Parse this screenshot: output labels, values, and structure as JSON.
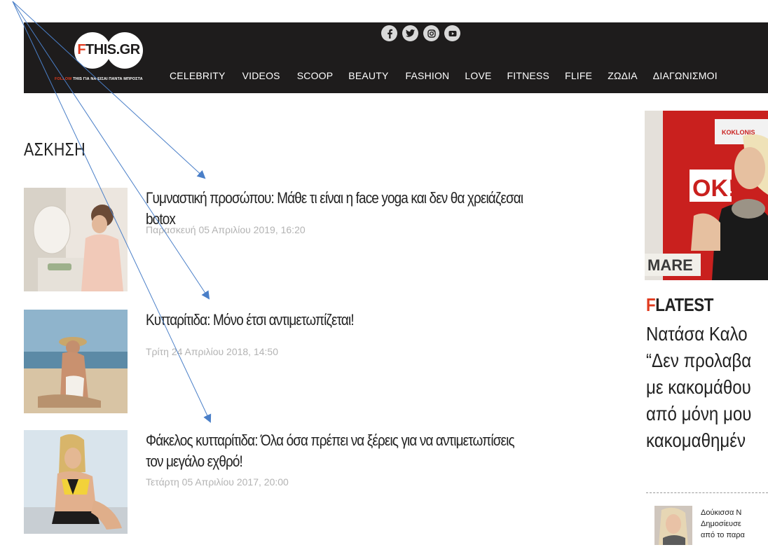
{
  "header": {
    "logo_text_f": "F",
    "logo_text_rest": "THIS.GR",
    "tagline_accent": "FOLLOW",
    "tagline_rest": " THIS ΓΙΑ ΝΑ ΕΙΣΑΙ ΠΑΝΤΑ ΜΠΡΟΣΤΑ",
    "socials": [
      "facebook-icon",
      "twitter-icon",
      "instagram-icon",
      "youtube-icon"
    ],
    "nav": [
      "CELEBRITY",
      "VIDEOS",
      "SCOOP",
      "BEAUTY",
      "FASHION",
      "LOVE",
      "FITNESS",
      "FLIFE",
      "ΖΩΔΙΑ",
      "ΔΙΑΓΩΝΙΣΜΟΙ"
    ]
  },
  "section": {
    "title": "ΑΣΚΗΣΗ"
  },
  "articles": [
    {
      "title": "Γυμναστική προσώπου: Μάθε τι είναι η face yoga και δεν θα χρειάζεσαι botox",
      "date": "Παρασκευή 05 Απριλίου 2019, 16:20"
    },
    {
      "title": "Κυτταρίτιδα: Μόνο έτσι αντιμετωπίζεται!",
      "date": "Τρίτη 24 Απριλίου 2018, 14:50"
    },
    {
      "title": "Φάκελος κυτταρίτιδα: Όλα όσα πρέπει να ξέρεις για να αντιμετωπίσεις τον μεγάλο εχθρό!",
      "date": "Τετάρτη 05 Απριλίου 2017, 20:00"
    }
  ],
  "sidebar": {
    "photo_sign_top": "KOKLONIS",
    "photo_sign_ok": "OK!",
    "photo_sign_mar": "MARE",
    "latest_f": "F",
    "latest_rest": "LATEST",
    "latest_lines": [
      "Νατάσα Καλο",
      "“Δεν προλαβα",
      "με κακομάθου",
      "από μόνη μου",
      "κακομαθημέν"
    ],
    "small_lines": [
      "Δούκισσα Ν",
      "Δημοσίευσε",
      "από το παρα"
    ]
  },
  "colors": {
    "header_bg": "#1e1c1c",
    "accent": "#e03a1e",
    "date": "#b3b3b3",
    "arrow": "#4a7fc8"
  }
}
